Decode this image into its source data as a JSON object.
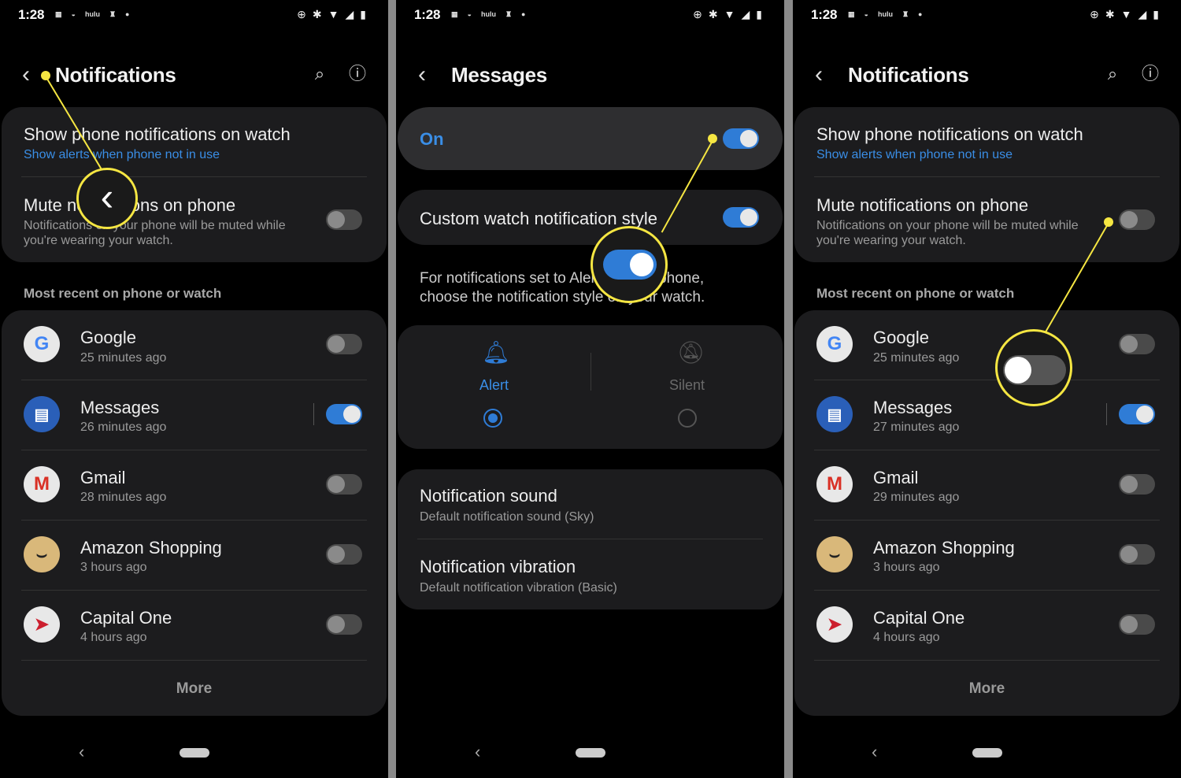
{
  "status": {
    "time": "1:28"
  },
  "panel1": {
    "title": "Notifications",
    "show_title": "Show phone notifications on watch",
    "show_sub": "Show alerts when phone not in use",
    "mute_title": "Mute notifications on phone",
    "mute_sub1": "Notifications on your phone will be muted while",
    "mute_sub2": "you're wearing your watch.",
    "section": "Most recent on phone or watch",
    "apps": [
      {
        "name": "Google",
        "time": "25 minutes ago",
        "on": false
      },
      {
        "name": "Messages",
        "time": "26 minutes ago",
        "on": true
      },
      {
        "name": "Gmail",
        "time": "28 minutes ago",
        "on": false
      },
      {
        "name": "Amazon Shopping",
        "time": "3 hours ago",
        "on": false
      },
      {
        "name": "Capital One",
        "time": "4 hours ago",
        "on": false
      }
    ],
    "more": "More"
  },
  "panel2": {
    "title": "Messages",
    "on_label": "On",
    "custom_title": "Custom watch notification style",
    "desc1": "For notifications set to Alert on your phone,",
    "desc2": "choose the notification style on your watch.",
    "alert": "Alert",
    "silent": "Silent",
    "sound_title": "Notification sound",
    "sound_sub": "Default notification sound (Sky)",
    "vib_title": "Notification vibration",
    "vib_sub": "Default notification vibration (Basic)"
  },
  "panel3": {
    "title": "Notifications",
    "show_title": "Show phone notifications on watch",
    "show_sub": "Show alerts when phone not in use",
    "mute_title": "Mute notifications on phone",
    "mute_sub1": "Notifications on your phone will be muted while",
    "mute_sub2": "you're wearing your watch.",
    "section": "Most recent on phone or watch",
    "apps": [
      {
        "name": "Google",
        "time": "25 minutes ago",
        "on": false
      },
      {
        "name": "Messages",
        "time": "27 minutes ago",
        "on": true
      },
      {
        "name": "Gmail",
        "time": "29 minutes ago",
        "on": false
      },
      {
        "name": "Amazon Shopping",
        "time": "3 hours ago",
        "on": false
      },
      {
        "name": "Capital One",
        "time": "4 hours ago",
        "on": false
      }
    ],
    "more": "More"
  },
  "colors": {
    "accent": "#2f7cd6",
    "callout": "#f5e642",
    "card": "#1c1c1e"
  },
  "icons": {
    "back": "chevron-left-icon",
    "search": "search-icon",
    "info": "info-icon"
  }
}
